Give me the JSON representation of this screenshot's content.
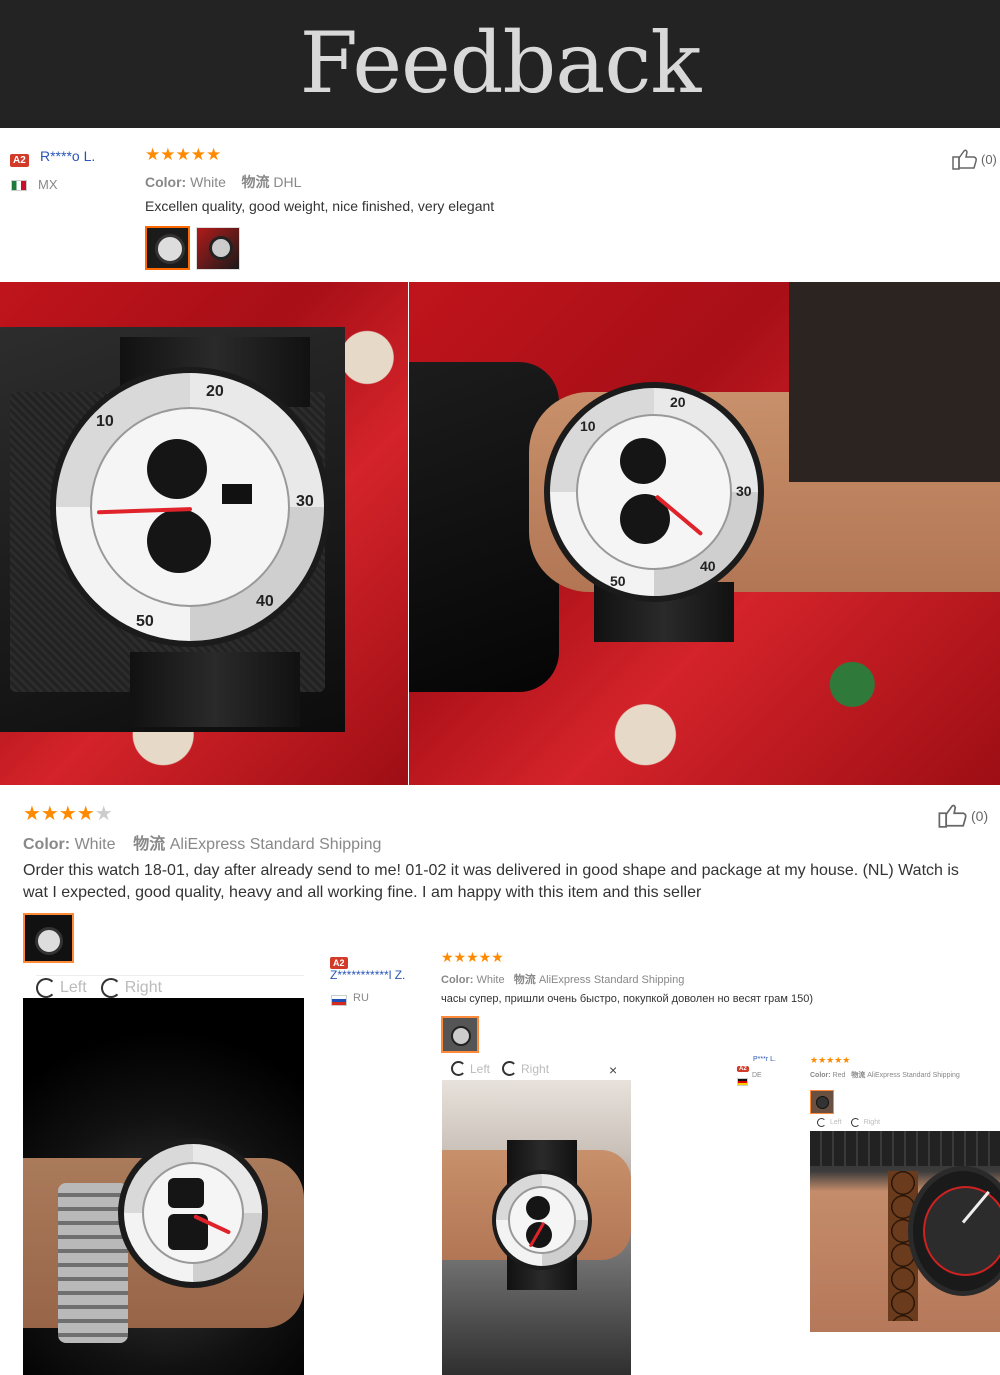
{
  "banner": {
    "title": "Feedback"
  },
  "review1": {
    "badge": "A2",
    "user": "R****o L.",
    "country": "MX",
    "stars": "★★★★★",
    "color_label": "Color:",
    "color_value": "White",
    "shipping_label": "物流",
    "shipping_value": "DHL",
    "text": "Excellen quality, good weight, nice finished, very elegant",
    "likes": "(0)",
    "thumb_icon": "thumbs-up-icon"
  },
  "photos_row": {
    "left": {
      "bezel_top": "20",
      "bezel_left": "10",
      "bezel_right": "30",
      "bezel_bottom": "50",
      "bezel_br": "40"
    },
    "right": {
      "bezel_top": "20",
      "bezel_left": "10",
      "bezel_right": "30",
      "bezel_bottom": "50",
      "bezel_br": "40"
    }
  },
  "review2": {
    "stars_on": "★★★★",
    "stars_off": "★",
    "color_label": "Color:",
    "color_value": "White",
    "shipping_label": "物流",
    "shipping_value": "AliExpress Standard Shipping",
    "text": "Order this watch 18-01, day after already send to me! 01-02 it was delivered in good shape and package at my house. (NL) Watch is wat I expected, good quality, heavy and all working fine. I am happy with this item and this seller",
    "likes": "(0)",
    "rotate_left": "Left",
    "rotate_right": "Right"
  },
  "review3": {
    "badge": "A2",
    "user": "Z***********l Z.",
    "country": "RU",
    "stars": "★★★★★",
    "color_label": "Color:",
    "color_value": "White",
    "shipping_label": "物流",
    "shipping_value": "AliExpress Standard Shipping",
    "text": "часы супер, пришли очень быстро, покупкой доволен но весят грам 150)",
    "rotate_left": "Left",
    "rotate_right": "Right",
    "close": "×"
  },
  "review4": {
    "badge": "A2",
    "user": "P***r L.",
    "country": "DE",
    "stars": "★★★★★",
    "color_label": "Color:",
    "color_value": "Red",
    "shipping_label": "物流",
    "shipping_value": "AliExpress Standard Shipping",
    "rotate_left": "Left",
    "rotate_right": "Right"
  },
  "colors": {
    "accent": "#ff6a00",
    "star": "#ff8a00",
    "link": "#2a55b8",
    "banner_bg": "#232323",
    "badge": "#d23a2a"
  }
}
